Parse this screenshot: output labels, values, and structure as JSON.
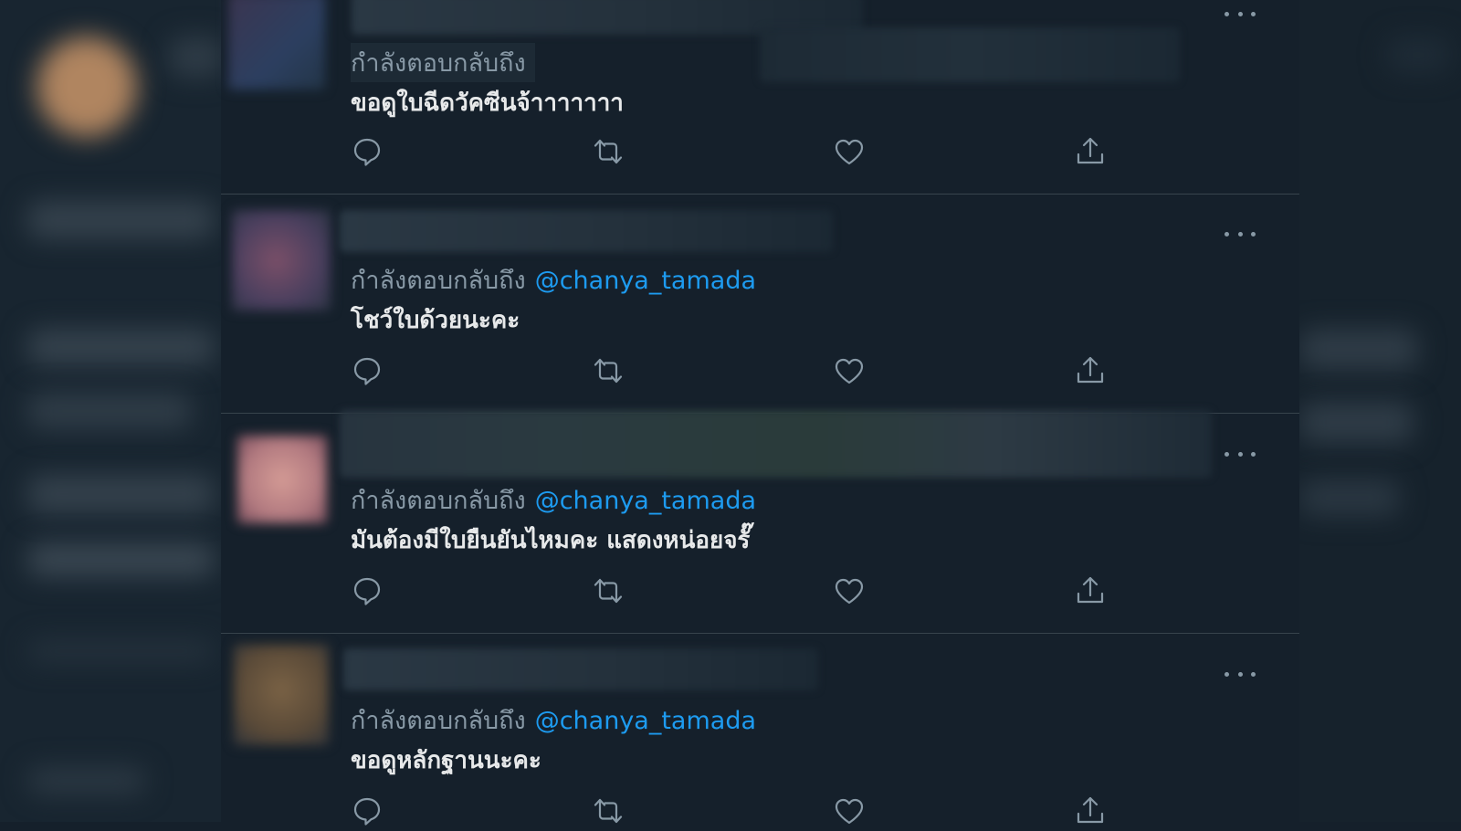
{
  "feed": {
    "tweets": [
      {
        "replying_label": "กำลังตอบกลับถึง",
        "mention": "",
        "text": "ขอดูใบฉีดวัคซีนจ้าาาาาาา"
      },
      {
        "replying_label": "กำลังตอบกลับถึง",
        "mention": "@chanya_tamada",
        "text": "โชว์ใบด้วยนะคะ"
      },
      {
        "replying_label": "กำลังตอบกลับถึง",
        "mention": "@chanya_tamada",
        "text": "มันต้องมีใบยืนยันไหมคะ แสดงหน่อยจรั๊"
      },
      {
        "replying_label": "กำลังตอบกลับถึง",
        "mention": "@chanya_tamada",
        "text": "ขอดูหลักฐานนะคะ"
      }
    ],
    "action_icons": [
      "reply-icon",
      "retweet-icon",
      "like-icon",
      "share-icon"
    ]
  },
  "colors": {
    "background": "#15202b",
    "divider": "#38444d",
    "muted_text": "#8899a6",
    "mention": "#1d9bf0",
    "body_text": "#e7e9ea"
  }
}
